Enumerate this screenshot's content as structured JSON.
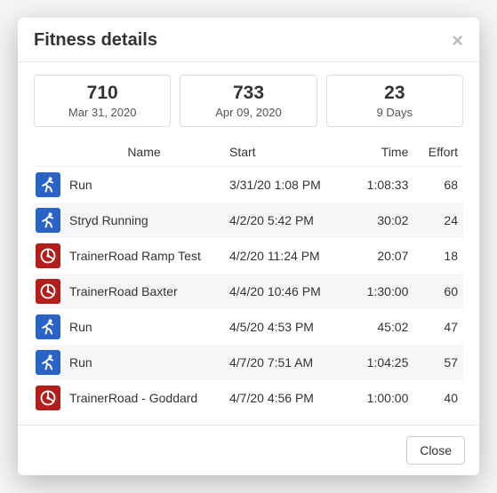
{
  "header": {
    "title": "Fitness details",
    "close_x": "×"
  },
  "stats": [
    {
      "value": "710",
      "label": "Mar 31, 2020"
    },
    {
      "value": "733",
      "label": "Apr 09, 2020"
    },
    {
      "value": "23",
      "label": "9 Days"
    }
  ],
  "table": {
    "columns": {
      "name": "Name",
      "start": "Start",
      "time": "Time",
      "effort": "Effort"
    }
  },
  "activities": [
    {
      "icon": "run",
      "name": "Run",
      "start": "3/31/20 1:08 PM",
      "time": "1:08:33",
      "effort": "68"
    },
    {
      "icon": "run",
      "name": "Stryd Running",
      "start": "4/2/20 5:42 PM",
      "time": "30:02",
      "effort": "24"
    },
    {
      "icon": "tr",
      "name": "TrainerRoad Ramp Test",
      "start": "4/2/20 11:24 PM",
      "time": "20:07",
      "effort": "18"
    },
    {
      "icon": "tr",
      "name": "TrainerRoad Baxter",
      "start": "4/4/20 10:46 PM",
      "time": "1:30:00",
      "effort": "60"
    },
    {
      "icon": "run",
      "name": "Run",
      "start": "4/5/20 4:53 PM",
      "time": "45:02",
      "effort": "47"
    },
    {
      "icon": "run",
      "name": "Run",
      "start": "4/7/20 7:51 AM",
      "time": "1:04:25",
      "effort": "57"
    },
    {
      "icon": "tr",
      "name": "TrainerRoad - Goddard",
      "start": "4/7/20 4:56 PM",
      "time": "1:00:00",
      "effort": "40"
    }
  ],
  "footer": {
    "close_label": "Close"
  }
}
